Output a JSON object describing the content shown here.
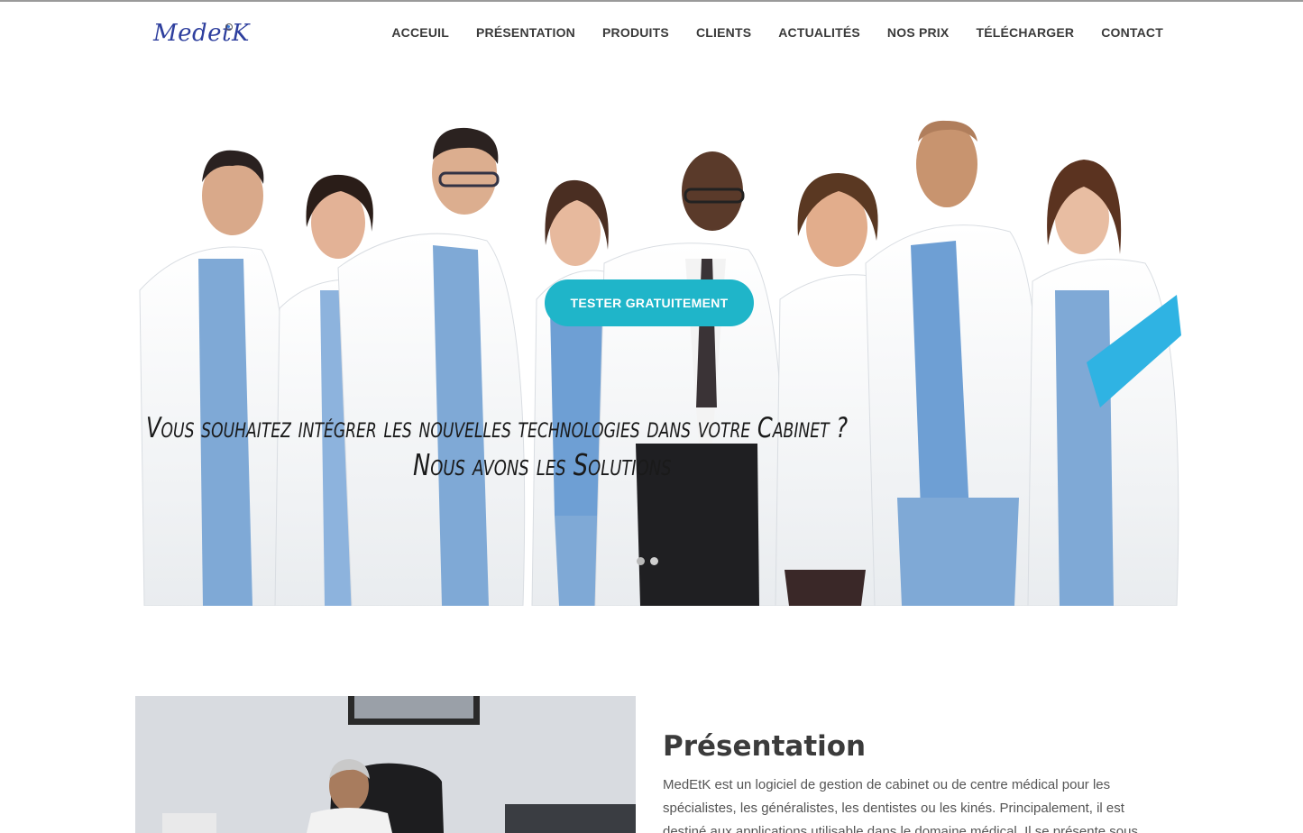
{
  "brand": {
    "logo_text": "MedetK",
    "accent": "#1fb5c9",
    "logo_color": "#2e3f9e"
  },
  "nav": {
    "items": [
      {
        "label": "ACCEUIL"
      },
      {
        "label": "PRÉSENTATION"
      },
      {
        "label": "PRODUITS"
      },
      {
        "label": "CLIENTS"
      },
      {
        "label": "ACTUALITÉS"
      },
      {
        "label": "NOS PRIX"
      },
      {
        "label": "TÉLÉCHARGER"
      },
      {
        "label": "CONTACT"
      }
    ]
  },
  "hero": {
    "cta_label": "TESTER GRATUITEMENT",
    "line1": "Vous souhaitez intégrer les nouvelles technologies dans votre Cabinet ?",
    "line2": "Nous avons les Solutions",
    "slide_count": 2,
    "active_slide": 1
  },
  "presentation": {
    "title": "Présentation",
    "body": "MedEtK est un logiciel de gestion de cabinet ou de centre médical pour les spécialistes, les généralistes, les dentistes ou les kinés. Principalement, il est destiné aux applications utilisable dans le domaine médical. Il se présente sous forme de logiciels informatiques"
  }
}
